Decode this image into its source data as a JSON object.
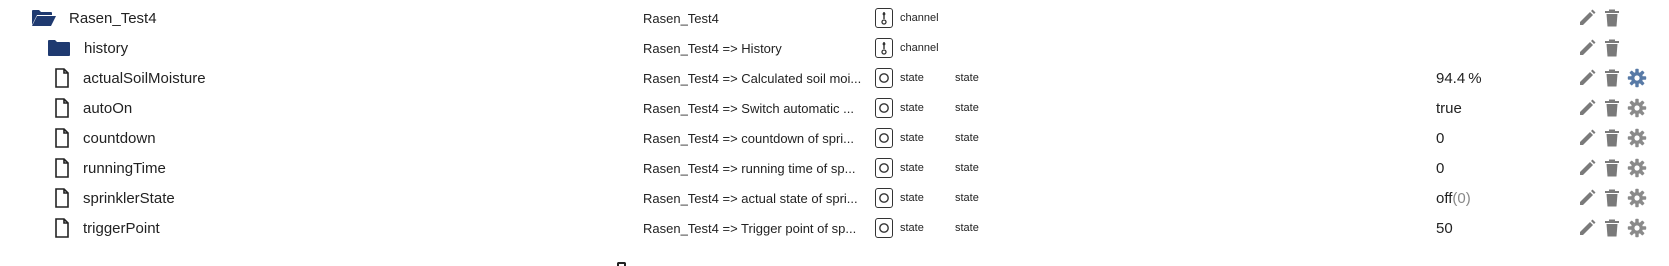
{
  "colors": {
    "folder": "#1f3a70",
    "action_icon": "#7a7a7a",
    "settings_icon_active": "#587aa6",
    "settings_icon_inactive": "#8a8a8a"
  },
  "rows": [
    {
      "name": "Rasen_Test4",
      "icon": "folder-open-icon",
      "description": "Rasen_Test4",
      "type": "channel",
      "role": "",
      "value": "",
      "unit": "",
      "sub": "",
      "settings": false
    },
    {
      "name": "history",
      "icon": "folder-icon",
      "description": "Rasen_Test4 => History",
      "type": "channel",
      "role": "",
      "value": "",
      "unit": "",
      "sub": "",
      "settings": false
    },
    {
      "name": "actualSoilMoisture",
      "icon": "file-icon",
      "description": "Rasen_Test4 => Calculated soil moi...",
      "type": "state",
      "role": "state",
      "value": "94.4",
      "unit": "%",
      "sub": "",
      "settings": "active"
    },
    {
      "name": "autoOn",
      "icon": "file-icon",
      "description": "Rasen_Test4 => Switch automatic ...",
      "type": "state",
      "role": "state",
      "value": "true",
      "unit": "",
      "sub": "",
      "settings": "inactive"
    },
    {
      "name": "countdown",
      "icon": "file-icon",
      "description": "Rasen_Test4 => countdown of spri...",
      "type": "state",
      "role": "state",
      "value": "0",
      "unit": "",
      "sub": "",
      "settings": "inactive"
    },
    {
      "name": "runningTime",
      "icon": "file-icon",
      "description": "Rasen_Test4 => running time of sp...",
      "type": "state",
      "role": "state",
      "value": "0",
      "unit": "",
      "sub": "",
      "settings": "inactive"
    },
    {
      "name": "sprinklerState",
      "icon": "file-icon",
      "description": "Rasen_Test4 => actual state of spri...",
      "type": "state",
      "role": "state",
      "value": "off",
      "unit": "",
      "sub": "(0)",
      "settings": "inactive"
    },
    {
      "name": "triggerPoint",
      "icon": "file-icon",
      "description": "Rasen_Test4 => Trigger point of sp...",
      "type": "state",
      "role": "state",
      "value": "50",
      "unit": "",
      "sub": "",
      "settings": "inactive"
    }
  ]
}
